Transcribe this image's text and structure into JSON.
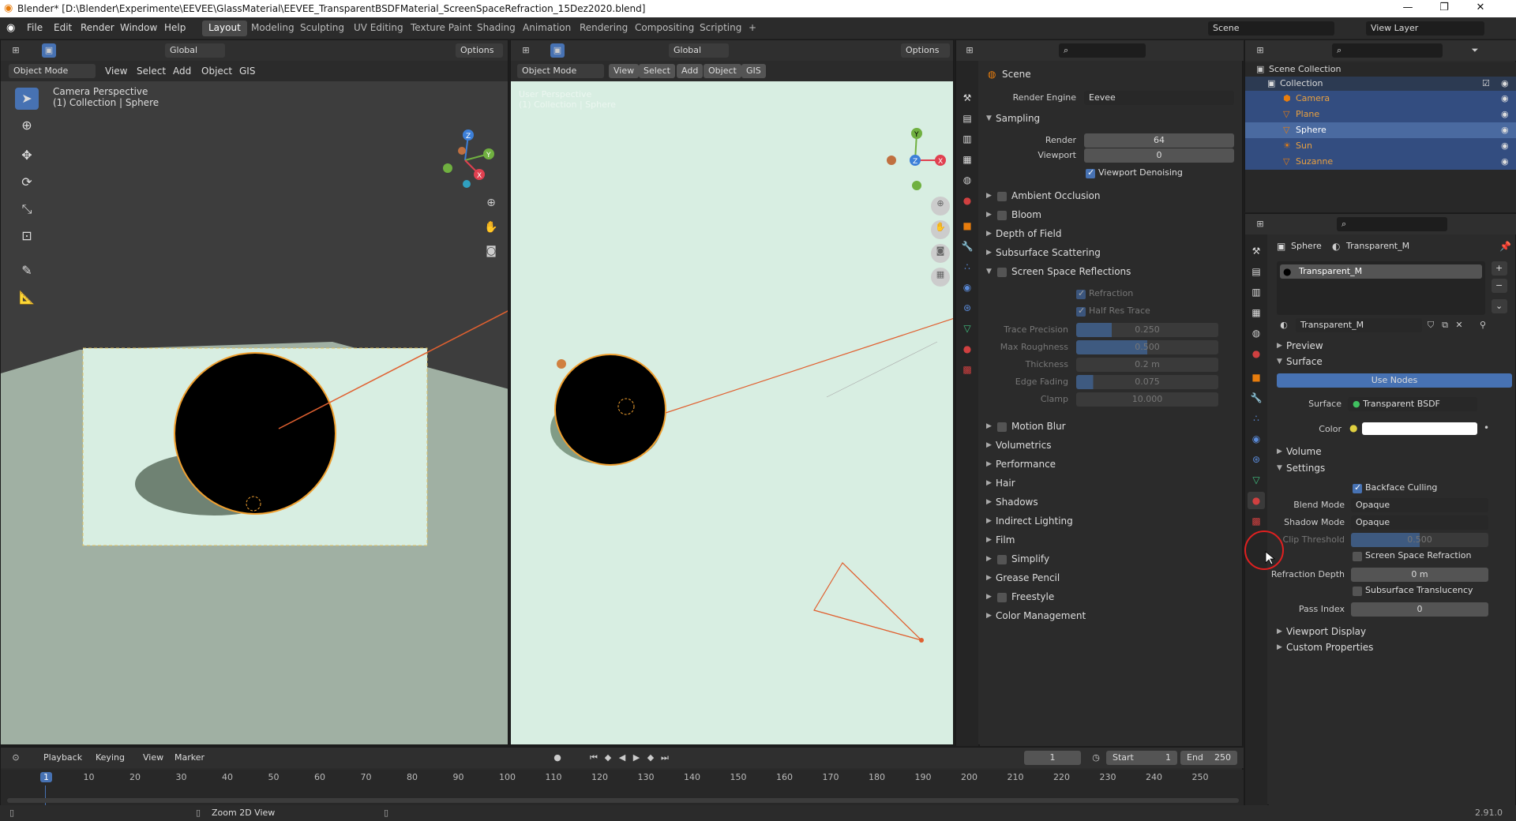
{
  "window": {
    "title": "Blender* [D:\\Blender\\Experimente\\EEVEE\\GlassMaterial\\EEVEE_TransparentBSDFMaterial_ScreenSpaceRefraction_15Dez2020.blend]",
    "minimize": "—",
    "maximize": "❐",
    "close": "✕"
  },
  "menu": {
    "file": "File",
    "edit": "Edit",
    "render": "Render",
    "window": "Window",
    "help": "Help"
  },
  "workspaces": [
    "Layout",
    "Modeling",
    "Sculpting",
    "UV Editing",
    "Texture Paint",
    "Shading",
    "Animation",
    "Rendering",
    "Compositing",
    "Scripting",
    "+"
  ],
  "scene": {
    "label": "Scene",
    "view_layer": "View Layer"
  },
  "vp1": {
    "orientation": "Global",
    "options": "Options",
    "mode": "Object Mode",
    "view": "View",
    "select": "Select",
    "add": "Add",
    "object": "Object",
    "gis": "GIS",
    "persp": "Camera Perspective",
    "coll": "(1) Collection | Sphere",
    "axes": {
      "x": "X",
      "y": "Y",
      "z": "Z"
    }
  },
  "vp2": {
    "orientation": "Global",
    "options": "Options",
    "mode": "Object Mode",
    "view": "View",
    "select": "Select",
    "add": "Add",
    "object": "Object",
    "gis": "GIS",
    "persp": "User Perspective",
    "coll": "(1) Collection | Sphere",
    "axes": {
      "x": "X",
      "y": "Y",
      "z": "Z"
    }
  },
  "render": {
    "scene": "Scene",
    "engine_label": "Render Engine",
    "engine": "Eevee",
    "sampling": "Sampling",
    "render_label": "Render",
    "render_val": "64",
    "viewport_label": "Viewport",
    "viewport_val": "0",
    "denoise": "Viewport Denoising",
    "panels": [
      "Ambient Occlusion",
      "Bloom",
      "Depth of Field",
      "Subsurface Scattering",
      "Screen Space Reflections"
    ],
    "ssr": {
      "refraction": "Refraction",
      "halfres": "Half Res Trace",
      "trace_precision": "Trace Precision",
      "trace_precision_val": "0.250",
      "max_roughness": "Max Roughness",
      "max_roughness_val": "0.500",
      "thickness": "Thickness",
      "thickness_val": "0.2 m",
      "edge_fading": "Edge Fading",
      "edge_fading_val": "0.075",
      "clamp": "Clamp",
      "clamp_val": "10.000"
    },
    "panels2": [
      "Motion Blur",
      "Volumetrics",
      "Performance",
      "Hair",
      "Shadows",
      "Indirect Lighting",
      "Film",
      "Simplify",
      "Grease Pencil",
      "Freestyle",
      "Color Management"
    ]
  },
  "outliner": {
    "root": "Scene Collection",
    "collection": "Collection",
    "items": [
      "Camera",
      "Plane",
      "Sphere",
      "Sun",
      "Suzanne"
    ]
  },
  "material": {
    "object": "Sphere",
    "material": "Transparent_M",
    "slot": "Transparent_M",
    "datablock": "Transparent_M",
    "preview": "Preview",
    "surface": "Surface",
    "use_nodes": "Use Nodes",
    "surface_label": "Surface",
    "surface_val": "Transparent BSDF",
    "color_label": "Color",
    "volume": "Volume",
    "settings": "Settings",
    "backface": "Backface Culling",
    "blend_label": "Blend Mode",
    "blend_val": "Opaque",
    "shadow_label": "Shadow Mode",
    "shadow_val": "Opaque",
    "clip_label": "Clip Threshold",
    "clip_val": "0.500",
    "ssr": "Screen Space Refraction",
    "refr_depth_label": "Refraction Depth",
    "refr_depth_val": "0 m",
    "sss": "Subsurface Translucency",
    "pass_label": "Pass Index",
    "pass_val": "0",
    "viewport_display": "Viewport Display",
    "custom_props": "Custom Properties"
  },
  "timeline": {
    "playback": "Playback",
    "keying": "Keying",
    "view": "View",
    "marker": "Marker",
    "frame": "1",
    "start_label": "Start",
    "start": "1",
    "end_label": "End",
    "end": "250",
    "ticks": [
      "1",
      "10",
      "20",
      "30",
      "40",
      "50",
      "60",
      "70",
      "80",
      "90",
      "100",
      "110",
      "120",
      "130",
      "140",
      "150",
      "160",
      "170",
      "180",
      "190",
      "200",
      "210",
      "220",
      "230",
      "240",
      "250"
    ]
  },
  "status": {
    "hint": "Zoom 2D View",
    "version": "2.91.0"
  },
  "colors": {
    "accent": "#4772b3",
    "orange": "#f0a030",
    "selected": "#334d80"
  }
}
